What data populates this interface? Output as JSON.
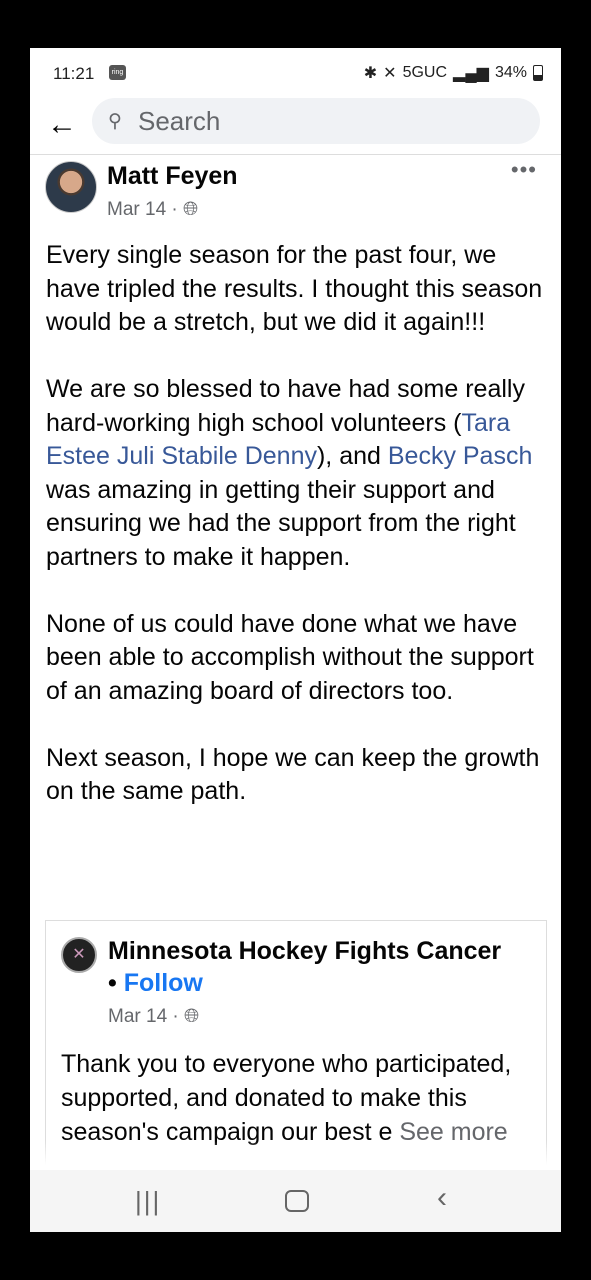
{
  "status_bar": {
    "time": "11:21",
    "badge": "ring",
    "network": "5GUC",
    "battery": "34%"
  },
  "search": {
    "placeholder": "Search"
  },
  "post": {
    "author": "Matt Feyen",
    "date": "Mar 14",
    "paragraph1": "Every single season for the past four, we have tripled the results.  I thought this season would be a stretch, but we did it again!!!",
    "p2_before": "We are so blessed to have had some really hard-working high school volunteers (",
    "p2_link1": "Tara Estee Juli Stabile Denny",
    "p2_middle": "), and ",
    "p2_link2": "Becky Pasch",
    "p2_after": " was amazing in getting their support and ensuring we had the support from the right partners to make it happen.",
    "paragraph3": "None of us could have done what we have been able to accomplish without the support of an amazing board of directors too.",
    "paragraph4": "Next season, I hope we can keep the growth on the same path."
  },
  "shared_post": {
    "page_name": "Minnesota Hockey Fights Cancer",
    "separator": "•",
    "follow_label": "Follow",
    "date": "Mar 14",
    "text": "Thank you to everyone who participated, supported, and donated to make this season's campaign our best e",
    "see_more": "See more"
  },
  "icons": {
    "back": "arrow-left-icon",
    "search": "search-icon",
    "globe": "globe-icon",
    "more": "more-options-icon"
  }
}
